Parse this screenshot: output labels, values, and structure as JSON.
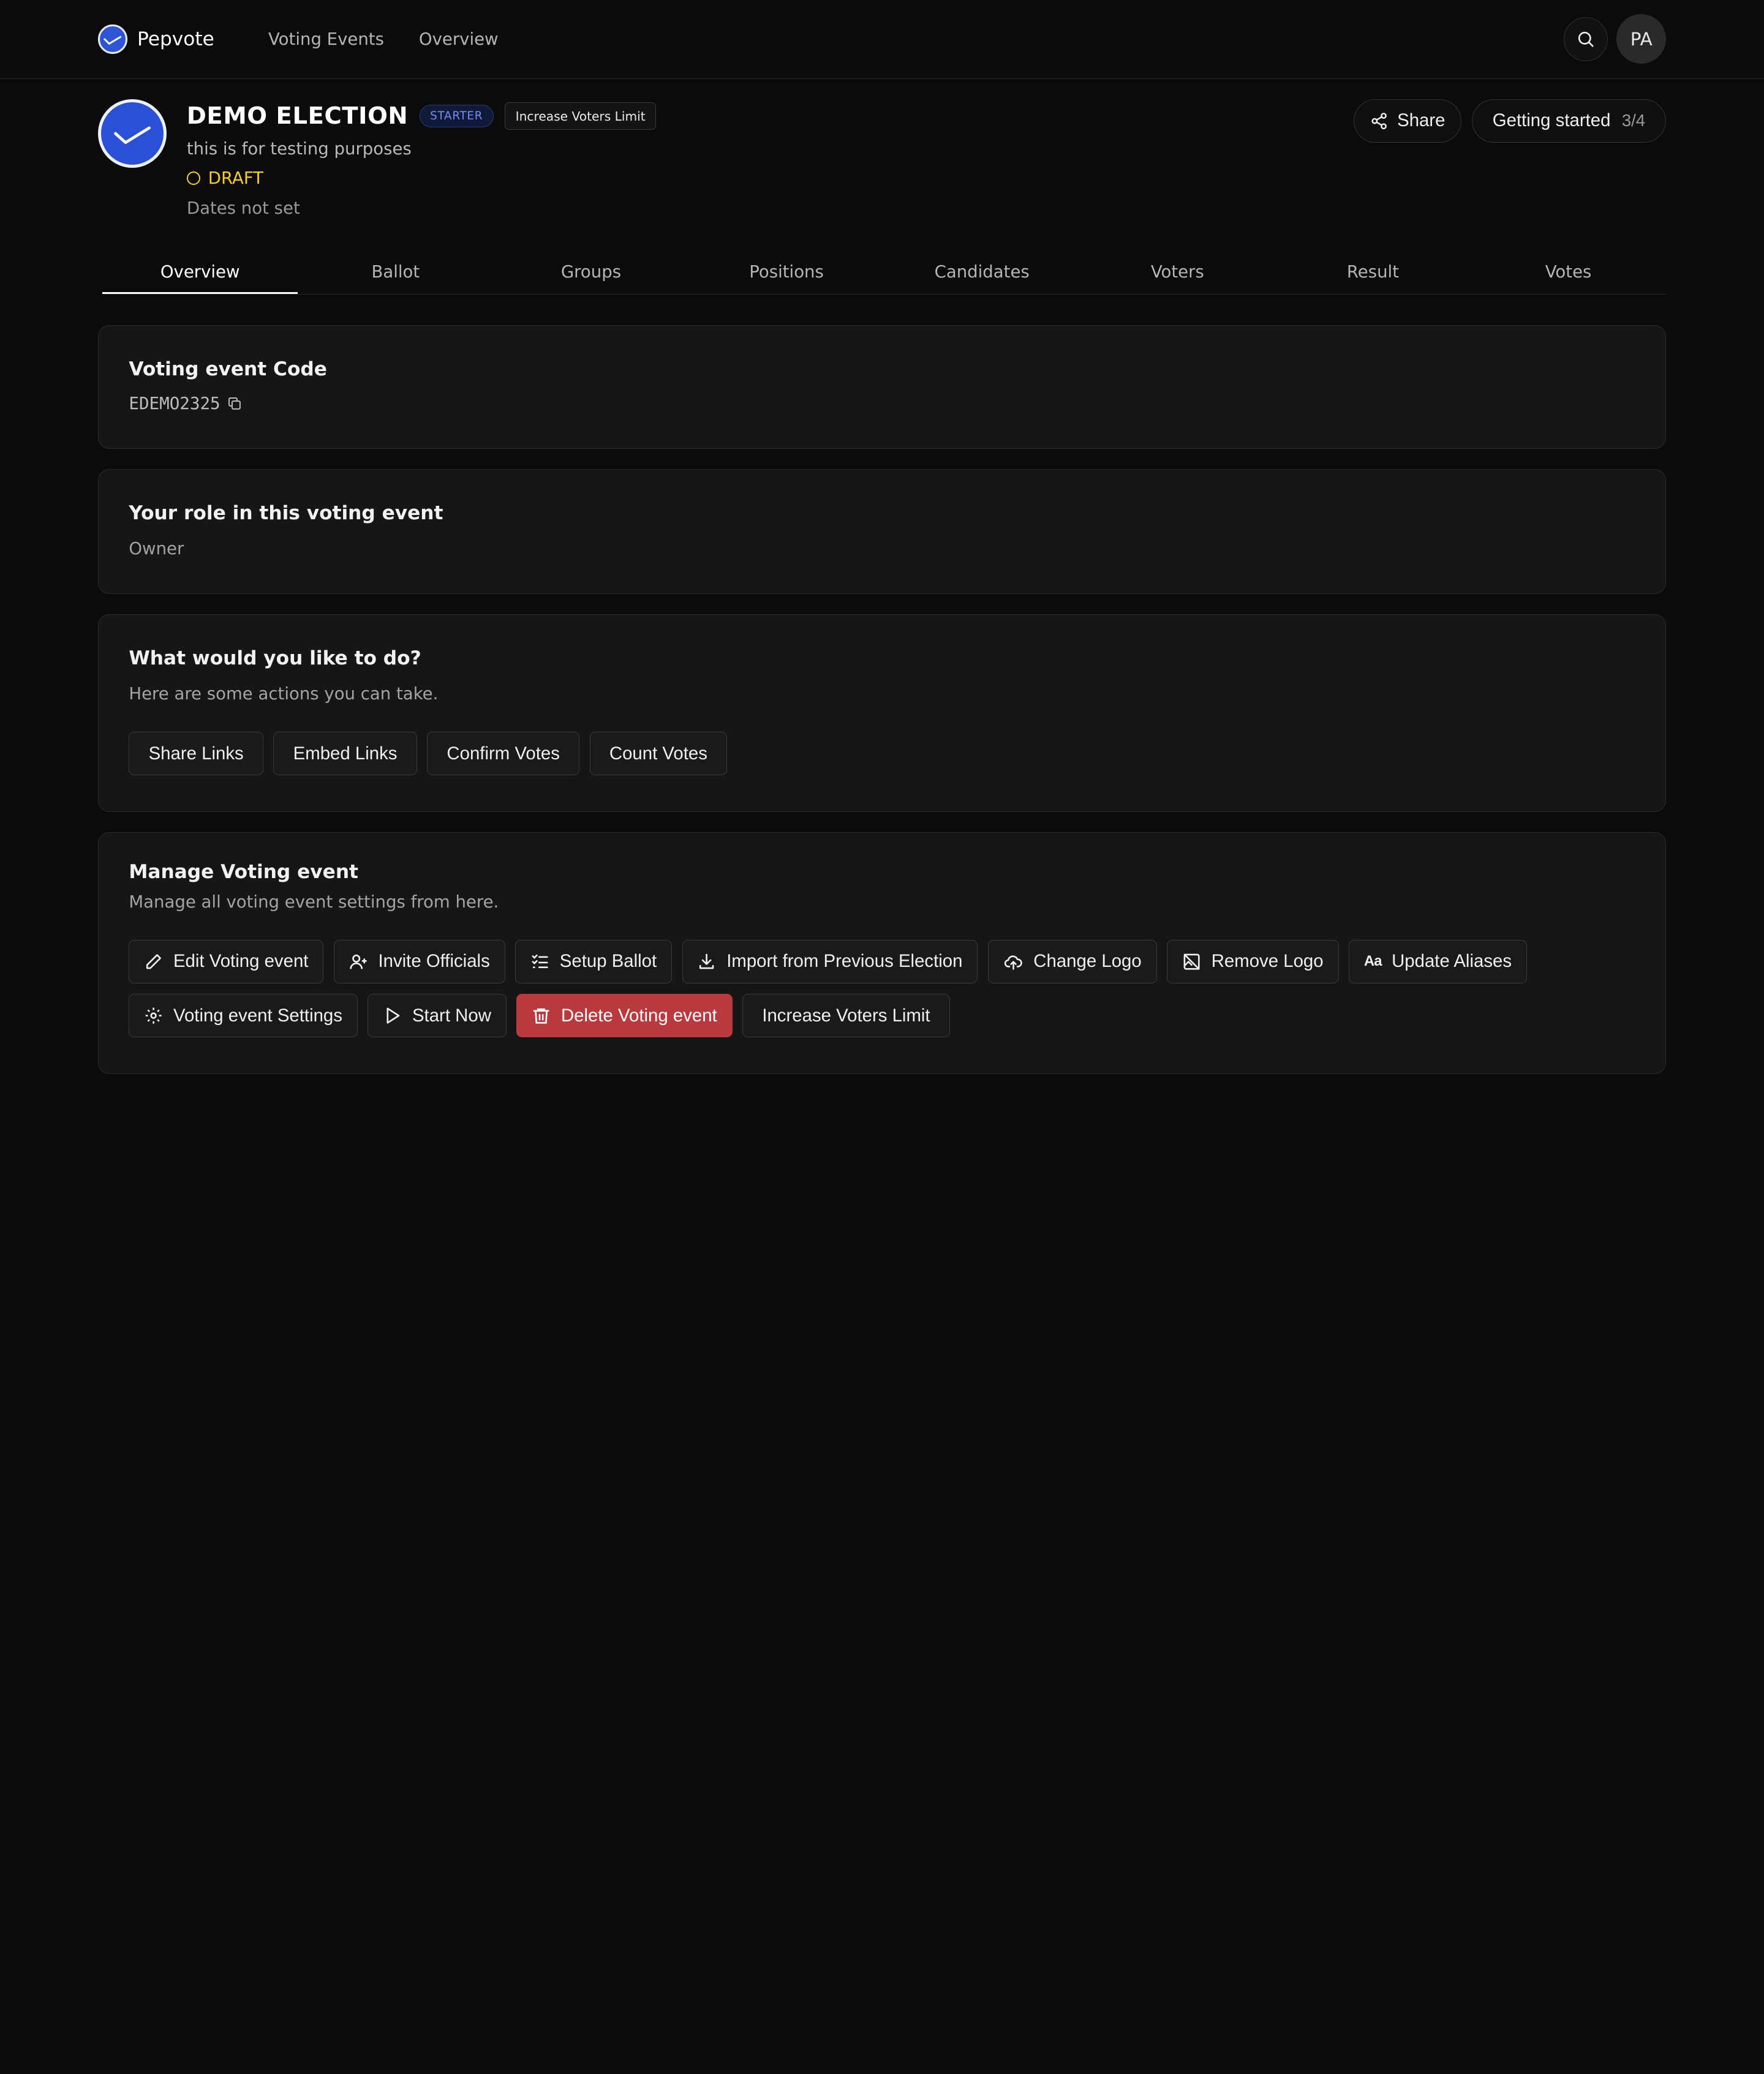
{
  "nav": {
    "brand": "Pepvote",
    "links": [
      "Voting Events",
      "Overview"
    ],
    "avatar_initials": "PA"
  },
  "event": {
    "title": "DEMO ELECTION",
    "plan_badge": "STARTER",
    "limit_badge": "Increase Voters Limit",
    "description": "this is for testing purposes",
    "status": "DRAFT",
    "dates": "Dates not set",
    "share_label": "Share",
    "getting_started_label": "Getting started",
    "getting_started_progress": "3/4"
  },
  "tabs": [
    "Overview",
    "Ballot",
    "Groups",
    "Positions",
    "Candidates",
    "Voters",
    "Result",
    "Votes"
  ],
  "active_tab": "Overview",
  "code_card": {
    "title": "Voting event Code",
    "code": "EDEMO2325"
  },
  "role_card": {
    "title": "Your role in this voting event",
    "role": "Owner"
  },
  "actions_card": {
    "title": "What would you like to do?",
    "subtitle": "Here are some actions you can take.",
    "buttons": [
      "Share Links",
      "Embed Links",
      "Confirm Votes",
      "Count Votes"
    ]
  },
  "manage_card": {
    "title": "Manage Voting event",
    "subtitle": "Manage all voting event settings from here.",
    "buttons": [
      {
        "label": "Edit Voting event",
        "icon": "pencil-icon"
      },
      {
        "label": "Invite Officials",
        "icon": "user-plus-icon"
      },
      {
        "label": "Setup Ballot",
        "icon": "list-check-icon"
      },
      {
        "label": "Import from Previous Election",
        "icon": "download-icon"
      },
      {
        "label": "Change Logo",
        "icon": "cloud-upload-icon"
      },
      {
        "label": "Remove Logo",
        "icon": "image-off-icon"
      },
      {
        "label": "Update Aliases",
        "icon": "font-case-icon"
      },
      {
        "label": "Voting event Settings",
        "icon": "gear-icon"
      },
      {
        "label": "Start Now",
        "icon": "play-icon"
      },
      {
        "label": "Delete Voting event",
        "icon": "trash-icon"
      },
      {
        "label": "Increase Voters Limit",
        "icon": ""
      }
    ]
  },
  "colors": {
    "background": "#0b0b0b",
    "card": "#161616",
    "accent_blue": "#2a50d6",
    "draft_yellow": "#f2cf2e",
    "danger": "#b83a3f"
  }
}
